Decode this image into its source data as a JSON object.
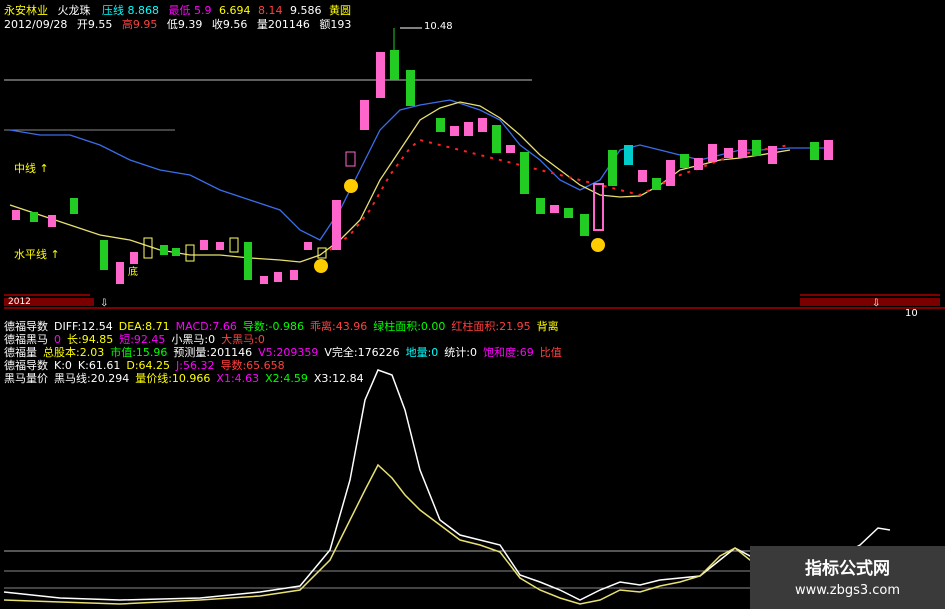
{
  "header": {
    "stock_name": "永安林业",
    "indicator_name": "火龙珠",
    "pressure_label": "压线",
    "pressure_value": "8.868",
    "stats_row1": [
      "最低",
      "5.9",
      "6.694",
      "8.14",
      "9.586",
      "黄圆"
    ],
    "date": "2012/09/28",
    "open_label": "开9.55",
    "high_label": "高9.95",
    "low_label": "低9.39",
    "close_label": "收9.56",
    "volume_label": "量201146",
    "amount_label": "额193"
  },
  "main_chart": {
    "peak_label": "10.48",
    "mid_line_label": "中线",
    "level_line_label": "水平线",
    "bottom_label": "底",
    "year_label": "2012",
    "right_label": "10"
  },
  "indicator_rows": [
    [
      {
        "text": "德福导数",
        "color": "#ffffff"
      },
      {
        "text": "DIFF:12.54",
        "color": "#ffffff"
      },
      {
        "text": "DEA:8.71",
        "color": "#ffff00"
      },
      {
        "text": "MACD:7.66",
        "color": "#ff00ff"
      },
      {
        "text": "导数:-0.986",
        "color": "#00ff00"
      },
      {
        "text": "乖离:43.96",
        "color": "#ff4040"
      },
      {
        "text": "绿柱面积:0.00",
        "color": "#00ff00"
      },
      {
        "text": "红柱面积:21.95",
        "color": "#ff4040"
      },
      {
        "text": "背离",
        "color": "#ffff00"
      }
    ],
    [
      {
        "text": "德福黑马",
        "color": "#ffffff"
      },
      {
        "text": "0",
        "color": "#ff00ff"
      },
      {
        "text": "长:94.85",
        "color": "#ffff00"
      },
      {
        "text": "短:92.45",
        "color": "#ff00ff"
      },
      {
        "text": "小黑马:0",
        "color": "#ffffff"
      },
      {
        "text": "大黑马:0",
        "color": "#ff4040"
      }
    ],
    [
      {
        "text": "德福量",
        "color": "#ffffff"
      },
      {
        "text": "总股本:2.03",
        "color": "#ffff00"
      },
      {
        "text": "市值:15.96",
        "color": "#00ff00"
      },
      {
        "text": "预测量:201146",
        "color": "#ffffff"
      },
      {
        "text": "V5:209359",
        "color": "#ff00ff"
      },
      {
        "text": "V完全:176226",
        "color": "#ffffff"
      },
      {
        "text": "地量:0",
        "color": "#00ffff"
      },
      {
        "text": "统计:0",
        "color": "#ffffff"
      },
      {
        "text": "饱和度:69",
        "color": "#ff00ff"
      },
      {
        "text": "比值",
        "color": "#ff4040"
      }
    ],
    [
      {
        "text": "德福导数",
        "color": "#ffffff"
      },
      {
        "text": "K:0",
        "color": "#ffffff"
      },
      {
        "text": "K:61.61",
        "color": "#ffffff"
      },
      {
        "text": "D:64.25",
        "color": "#ffff00"
      },
      {
        "text": "J:56.32",
        "color": "#ff00ff"
      },
      {
        "text": "导数:65.658",
        "color": "#ff4040"
      }
    ],
    [
      {
        "text": "黑马量价",
        "color": "#ffffff"
      },
      {
        "text": "黑马线:20.294",
        "color": "#ffffff"
      },
      {
        "text": "量价线:10.966",
        "color": "#ffff00"
      },
      {
        "text": "X1:4.63",
        "color": "#ff00ff"
      },
      {
        "text": "X2:4.59",
        "color": "#00ff00"
      },
      {
        "text": "X3:12.84",
        "color": "#ffffff"
      }
    ]
  ],
  "watermark": {
    "title": "指标公式网",
    "url": "www.zbgs3.com"
  }
}
